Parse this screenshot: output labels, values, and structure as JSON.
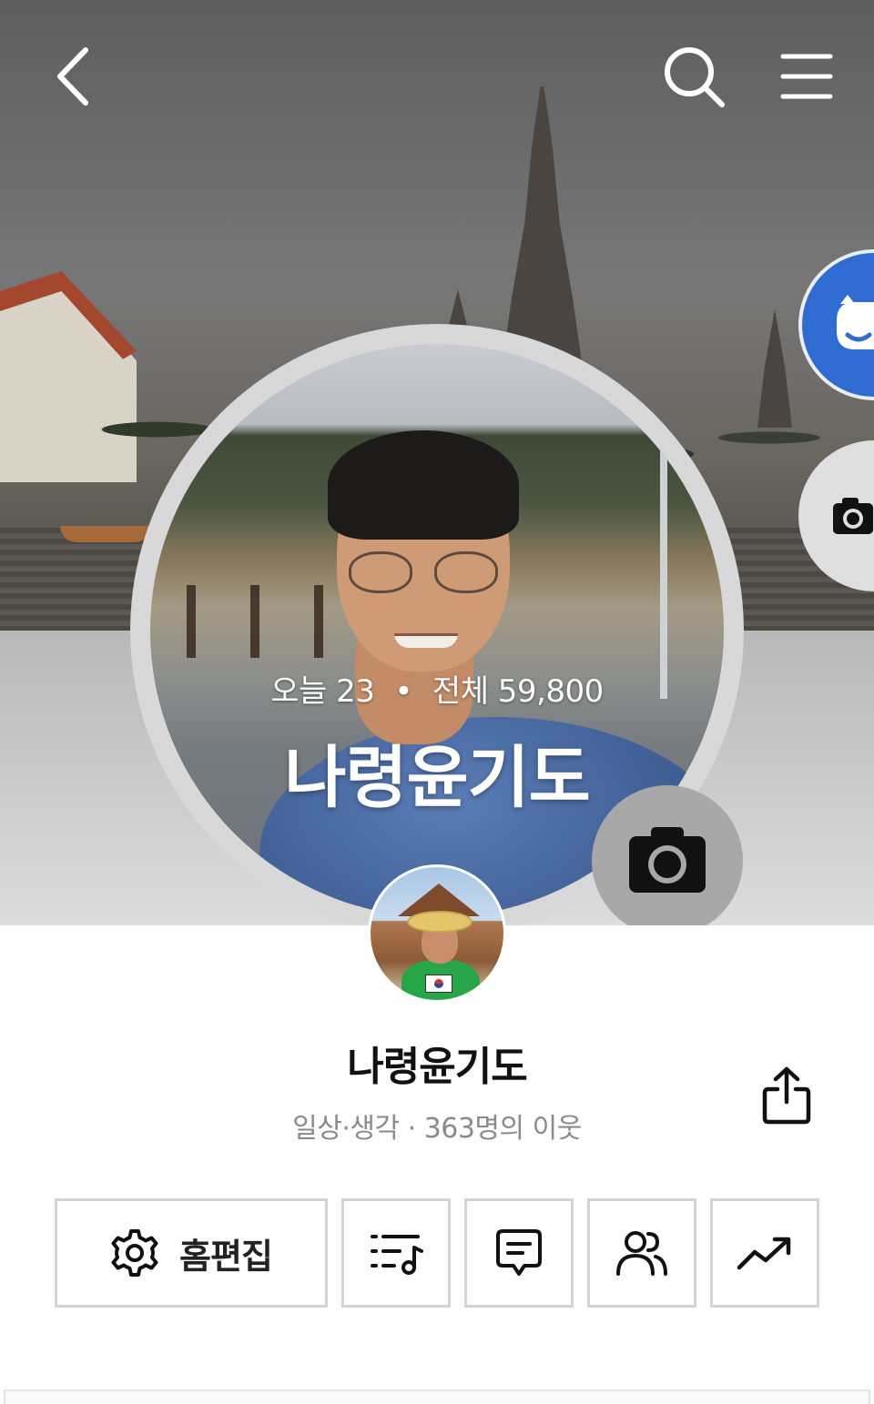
{
  "cover": {
    "visit_today": "오늘 23",
    "visit_separator": "•",
    "visit_total": "전체 59,800",
    "title": "나령윤기도"
  },
  "topbar": {
    "back_icon": "chevron-left-icon",
    "search_icon": "search-icon",
    "menu_icon": "hamburger-menu-icon"
  },
  "profile": {
    "blog_name": "나령윤기도",
    "meta": "일상·생각 · 363명의 이웃"
  },
  "actions": {
    "edit_label": "홈편집",
    "edit_icon": "gear-icon",
    "buttons": [
      "playlist-icon",
      "comment-icon",
      "neighbors-icon",
      "stats-trend-icon"
    ]
  },
  "colors": {
    "accent_blue": "#2f6bd1",
    "button_border": "#d3d3d3",
    "meta_gray": "#8a8a8a"
  }
}
